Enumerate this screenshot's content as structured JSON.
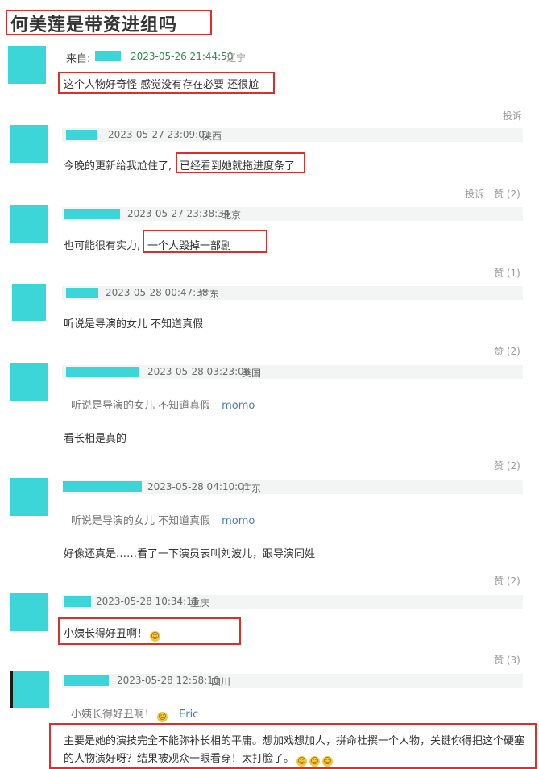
{
  "title": "何美莲是带资进组吗",
  "first_post": {
    "from_label": "来自:",
    "time": "2023-05-26 21:44:50",
    "location": "辽宁",
    "text": "这个人物好奇怪 感觉没有存在必要 还很尬",
    "report": "投诉"
  },
  "comments": [
    {
      "time": "2023-05-27 23:09:02",
      "location": "陕西",
      "text_a": "今晚的更新给我尬住了,",
      "text_b": "已经看到她就拖进度条了",
      "report": "投诉",
      "likes": "赞 (2)"
    },
    {
      "time": "2023-05-27 23:38:34",
      "location": "北京",
      "text_a": "也可能很有实力,",
      "text_b": "一个人毁掉一部剧",
      "likes": "赞 (1)"
    },
    {
      "time": "2023-05-28 00:47:38",
      "location": "广东",
      "text": "听说是导演的女儿 不知道真假",
      "likes": "赞 (2)"
    },
    {
      "time": "2023-05-28 03:23:06",
      "location": "美国",
      "quote": "听说是导演的女儿 不知道真假",
      "quote_user": "momo",
      "text": "看长相是真的",
      "likes": "赞 (2)"
    },
    {
      "time": "2023-05-28 04:10:01",
      "location": "广东",
      "quote": "听说是导演的女儿 不知道真假",
      "quote_user": "momo",
      "text": "好像还真是……看了一下演员表叫刘波儿，跟导演同姓",
      "likes": "赞 (2)"
    },
    {
      "time": "2023-05-28 10:34:11",
      "location": "重庆",
      "text": "小姨长得好丑啊！",
      "likes": "赞 (3)"
    },
    {
      "time": "2023-05-28 12:58:10",
      "location": "四川",
      "quote": "小姨长得好丑啊！",
      "quote_user": "Eric",
      "text": "主要是她的演技完全不能弥补长相的平庸。想加戏想加人，拼命杜撰一个人物，关键你得把这个硬塞的人物演好呀？结果被观众一眼看穿！太打脸了。"
    }
  ]
}
